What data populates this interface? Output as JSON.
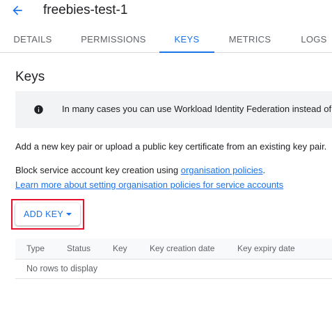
{
  "header": {
    "back_icon": "arrow-back-icon",
    "title": "freebies-test-1"
  },
  "tabs": [
    {
      "label": "DETAILS",
      "active": false
    },
    {
      "label": "PERMISSIONS",
      "active": false
    },
    {
      "label": "KEYS",
      "active": true
    },
    {
      "label": "METRICS",
      "active": false
    },
    {
      "label": "LOGS",
      "active": false
    }
  ],
  "keys_section": {
    "title": "Keys",
    "banner": {
      "icon": "info-icon",
      "text": "In many cases you can use Workload Identity Federation instead of"
    },
    "description": "Add a new key pair or upload a public key certificate from an existing key pair.",
    "block_text": "Block service account key creation using ",
    "block_link": "organisation policies",
    "block_suffix": ".",
    "learn_more_link": "Learn more about setting organisation policies for service accounts",
    "add_key_button": "ADD KEY",
    "add_key_caret_icon": "caret-down-icon"
  },
  "table": {
    "columns": [
      "Type",
      "Status",
      "Key",
      "Key creation date",
      "Key expiry date"
    ],
    "empty_text": "No rows to display"
  },
  "colors": {
    "accent": "#1a73e8",
    "highlight": "#e8112d",
    "banner_bg": "#f1f3f4"
  }
}
